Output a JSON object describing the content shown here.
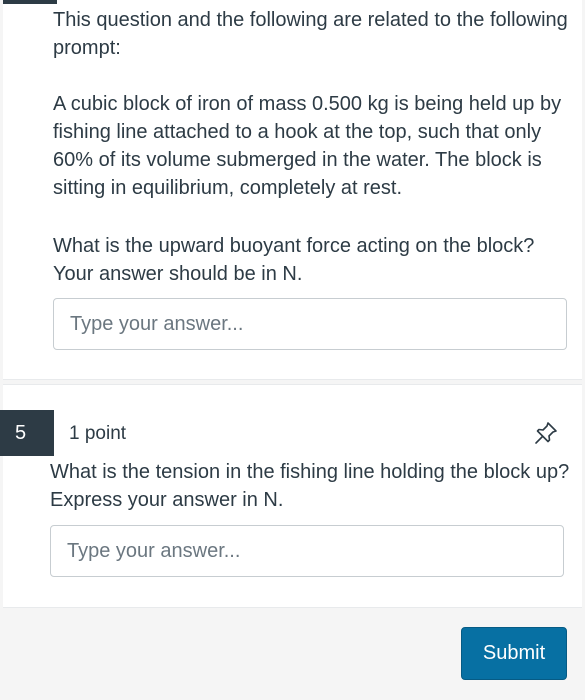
{
  "question4": {
    "prompt_intro": "This question and the following are related to the following prompt:",
    "prompt_body": "A cubic block of iron of mass 0.500 kg is being held up by fishing line attached to a hook at the top, such that only 60% of its volume submerged in the water. The block is sitting in equilibrium, completely at rest.",
    "question_text": "What is the upward buoyant force acting on the block? Your answer should be in N.",
    "answer_value": "",
    "answer_placeholder": "Type your answer..."
  },
  "question5": {
    "number": "5",
    "points": "1 point",
    "pin_icon": "pin-icon",
    "question_text": "What is the tension in the fishing line holding the block up? Express your answer in N.",
    "answer_value": "",
    "answer_placeholder": "Type your answer..."
  },
  "footer": {
    "submit_label": "Submit"
  },
  "colors": {
    "text": "#2d3b45",
    "accent": "#0770a3",
    "number_badge": "#2d3b45",
    "input_border": "#c7cdd1"
  }
}
